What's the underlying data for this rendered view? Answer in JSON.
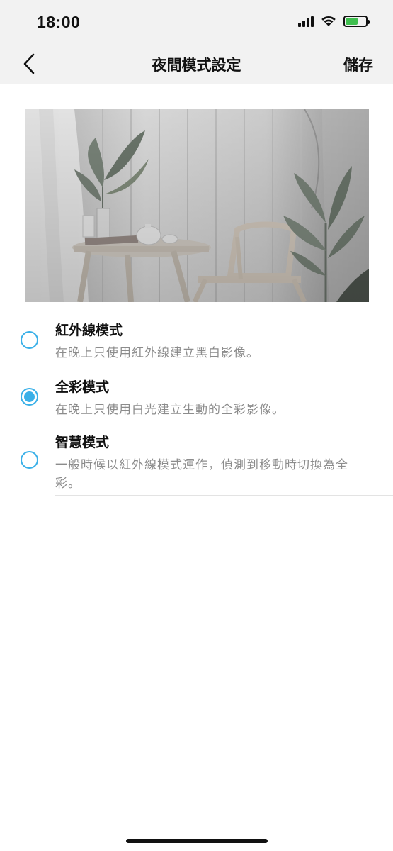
{
  "status_bar": {
    "time": "18:00",
    "icons": [
      "signal-icon",
      "wifi-icon",
      "battery-icon"
    ],
    "battery_color": "#3fbf4f"
  },
  "nav": {
    "back_icon": "chevron-left-icon",
    "title": "夜間模式設定",
    "save_label": "儲存"
  },
  "preview": {
    "description_icon": "camera-preview-image"
  },
  "accent_color": "#3ab0e8",
  "options": [
    {
      "title": "紅外線模式",
      "description": "在晚上只使用紅外線建立黑白影像。",
      "selected": false
    },
    {
      "title": "全彩模式",
      "description": "在晚上只使用白光建立生動的全彩影像。",
      "selected": true
    },
    {
      "title": "智慧模式",
      "description": "一般時候以紅外線模式運作，偵測到移動時切換為全彩。",
      "selected": false
    }
  ]
}
